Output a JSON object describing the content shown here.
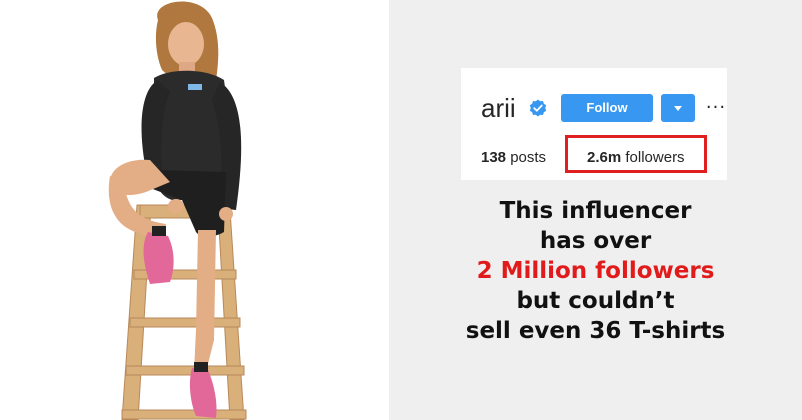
{
  "profile": {
    "username": "arii",
    "follow_label": "Follow",
    "more_label": "···",
    "posts_count": "138",
    "posts_label": "posts",
    "followers_count": "2.6m",
    "followers_label": "followers"
  },
  "caption": {
    "line1": "This influencer",
    "line2": "has over",
    "line3": "2 Million followers",
    "line4": "but couldn’t",
    "line5": "sell even 36 T-shirts"
  },
  "colors": {
    "follow_button": "#3897f0",
    "highlight_red": "#e11b1b",
    "verified_badge": "#3897f0"
  },
  "icons": {
    "verified": "verified-badge-icon",
    "dropdown": "chevron-down-icon",
    "more": "more-options-icon"
  }
}
